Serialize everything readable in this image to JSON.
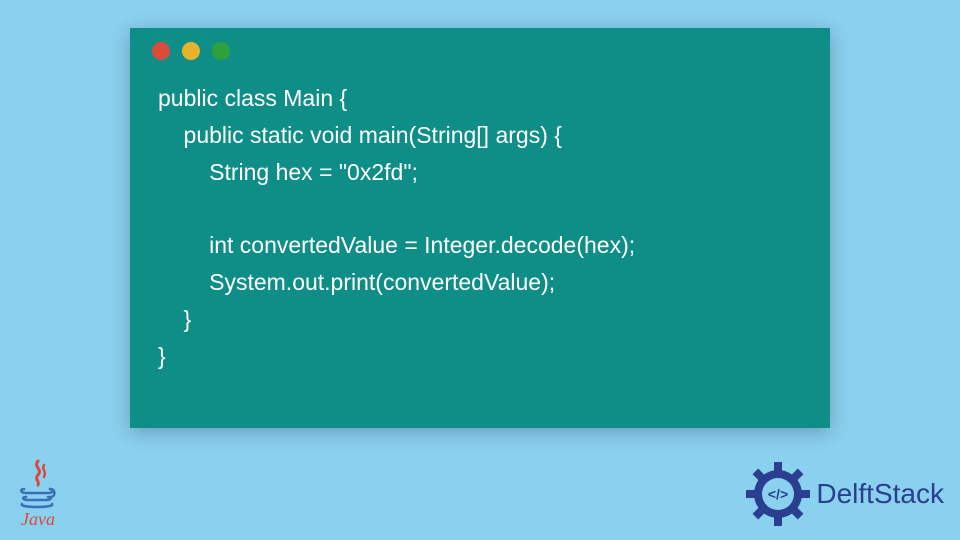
{
  "code": {
    "lines": [
      "public class Main {",
      "    public static void main(String[] args) {",
      "        String hex = \"0x2fd\";",
      "",
      "        int convertedValue = Integer.decode(hex);",
      "        System.out.print(convertedValue);",
      "    }",
      "}"
    ]
  },
  "logos": {
    "java": "Java",
    "delft": "DelftStack"
  },
  "colors": {
    "bg": "#8ad0ef",
    "window": "#0e8e87",
    "red": "#d94b3a",
    "yellow": "#e8b32a",
    "green": "#2fa13a",
    "delft": "#2a3f8f"
  }
}
